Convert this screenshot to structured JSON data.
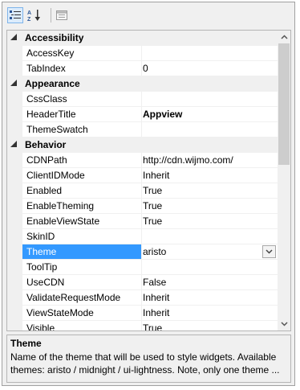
{
  "toolbar": {
    "categorized_icon": "categorized-icon",
    "alphabetical_icon": "alphabetical-icon",
    "property_pages_icon": "property-pages-icon"
  },
  "categories": [
    {
      "label": "Accessibility",
      "properties": [
        {
          "name": "AccessKey",
          "value": ""
        },
        {
          "name": "TabIndex",
          "value": "0"
        }
      ]
    },
    {
      "label": "Appearance",
      "properties": [
        {
          "name": "CssClass",
          "value": ""
        },
        {
          "name": "HeaderTitle",
          "value": "Appview"
        },
        {
          "name": "ThemeSwatch",
          "value": ""
        }
      ]
    },
    {
      "label": "Behavior",
      "properties": [
        {
          "name": "CDNPath",
          "value": "http://cdn.wijmo.com/"
        },
        {
          "name": "ClientIDMode",
          "value": "Inherit"
        },
        {
          "name": "Enabled",
          "value": "True"
        },
        {
          "name": "EnableTheming",
          "value": "True"
        },
        {
          "name": "EnableViewState",
          "value": "True"
        },
        {
          "name": "SkinID",
          "value": ""
        },
        {
          "name": "Theme",
          "value": "aristo"
        },
        {
          "name": "ToolTip",
          "value": ""
        },
        {
          "name": "UseCDN",
          "value": "False"
        },
        {
          "name": "ValidateRequestMode",
          "value": "Inherit"
        },
        {
          "name": "ViewStateMode",
          "value": "Inherit"
        },
        {
          "name": "Visible",
          "value": "True"
        }
      ]
    }
  ],
  "selected_property": "Theme",
  "description": {
    "title": "Theme",
    "text": "Name of the theme that will be used to style widgets. Available themes: aristo / midnight / ui-lightness. Note, only one theme ..."
  },
  "colors": {
    "selection": "#3399ff",
    "category_bg": "#f0f0f0"
  }
}
